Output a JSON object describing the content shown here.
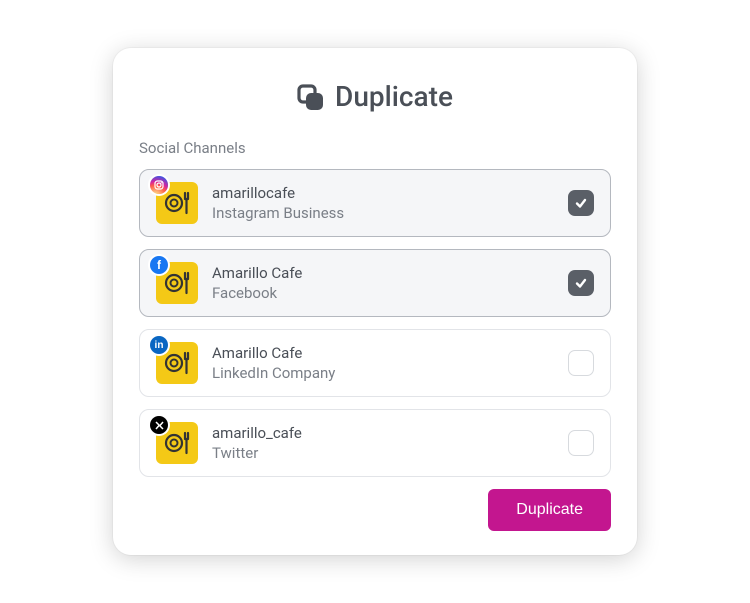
{
  "title": "Duplicate",
  "section_label": "Social Channels",
  "channels": [
    {
      "name": "amarillocafe",
      "platform": "Instagram Business",
      "network": "instagram",
      "selected": true
    },
    {
      "name": "Amarillo Cafe",
      "platform": "Facebook",
      "network": "facebook",
      "selected": true
    },
    {
      "name": "Amarillo Cafe",
      "platform": "LinkedIn Company",
      "network": "linkedin",
      "selected": false
    },
    {
      "name": "amarillo_cafe",
      "platform": "Twitter",
      "network": "twitter",
      "selected": false
    }
  ],
  "button_label": "Duplicate"
}
